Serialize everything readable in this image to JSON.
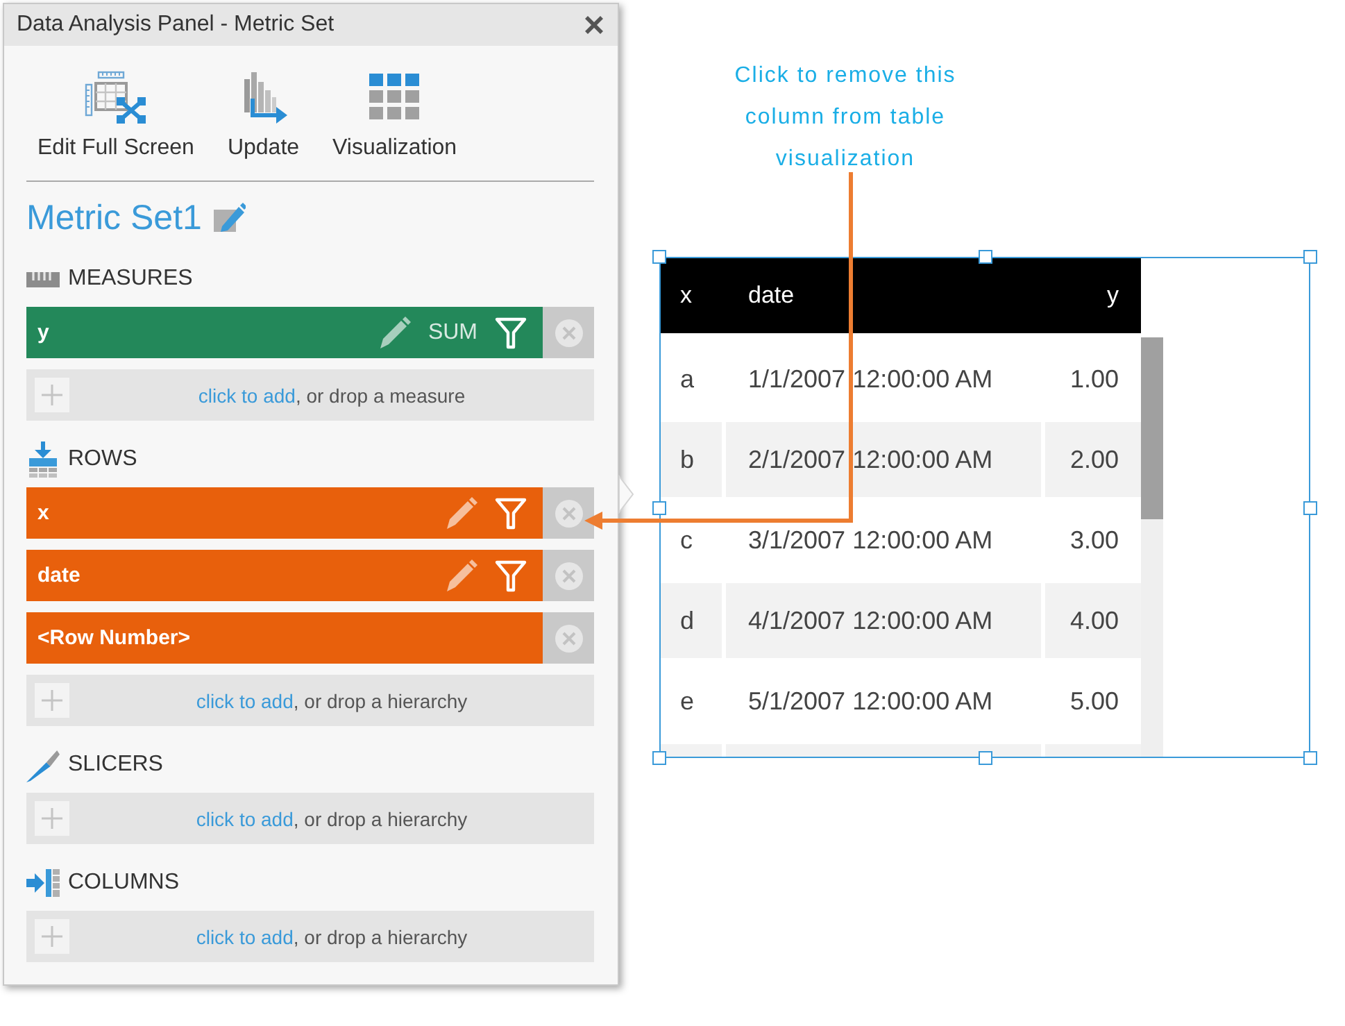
{
  "panel": {
    "title": "Data Analysis Panel - Metric Set",
    "toolbar": [
      {
        "kind": "edit_full_screen",
        "label": "Edit Full Screen"
      },
      {
        "kind": "update",
        "label": "Update"
      },
      {
        "kind": "visualization",
        "label": "Visualization"
      }
    ],
    "metric_set": {
      "name": "Metric Set1"
    },
    "sections": [
      {
        "kind": "measures",
        "title": "MEASURES",
        "items": [
          {
            "label": "y",
            "aggregate": "SUM",
            "editable": true,
            "filterable": true
          }
        ],
        "drop_hint": {
          "link": "click to add",
          "text": ", or drop a measure"
        }
      },
      {
        "kind": "rows",
        "title": "ROWS",
        "items": [
          {
            "label": "x",
            "editable": true,
            "filterable": true
          },
          {
            "label": "date",
            "editable": true,
            "filterable": true
          },
          {
            "label": "<Row Number>",
            "editable": false,
            "filterable": false
          }
        ],
        "drop_hint": {
          "link": "click to add",
          "text": ", or drop a hierarchy"
        }
      },
      {
        "kind": "slicers",
        "title": "SLICERS",
        "drop_hint": {
          "link": "click to add",
          "text": ", or drop a hierarchy"
        }
      },
      {
        "kind": "columns",
        "title": "COLUMNS",
        "drop_hint": {
          "link": "click to add",
          "text": ", or drop a hierarchy"
        }
      }
    ]
  },
  "annotation": {
    "text": "Click to remove this column from table visualization"
  },
  "table": {
    "selected": true,
    "columns": [
      {
        "label": "x",
        "kind": "text"
      },
      {
        "label": "date",
        "kind": "text"
      },
      {
        "label": "y",
        "kind": "number"
      }
    ],
    "rows": [
      [
        "a",
        "1/1/2007 12:00:00 AM",
        "1.00"
      ],
      [
        "b",
        "2/1/2007 12:00:00 AM",
        "2.00"
      ],
      [
        "c",
        "3/1/2007 12:00:00 AM",
        "3.00"
      ],
      [
        "d",
        "4/1/2007 12:00:00 AM",
        "4.00"
      ],
      [
        "e",
        "5/1/2007 12:00:00 AM",
        "5.00"
      ]
    ]
  }
}
